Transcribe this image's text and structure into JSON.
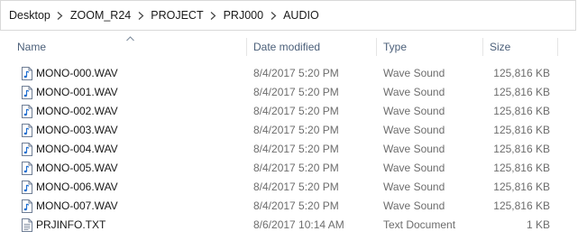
{
  "breadcrumb": [
    "Desktop",
    "ZOOM_R24",
    "PROJECT",
    "PRJ000",
    "AUDIO"
  ],
  "columns": {
    "name": "Name",
    "date": "Date modified",
    "type": "Type",
    "size": "Size"
  },
  "sort": {
    "column": "name",
    "direction": "ascending"
  },
  "files": [
    {
      "name": "MONO-000.WAV",
      "date": "8/4/2017 5:20 PM",
      "type": "Wave Sound",
      "size": "125,816 KB",
      "icon": "audio-file-icon"
    },
    {
      "name": "MONO-001.WAV",
      "date": "8/4/2017 5:20 PM",
      "type": "Wave Sound",
      "size": "125,816 KB",
      "icon": "audio-file-icon"
    },
    {
      "name": "MONO-002.WAV",
      "date": "8/4/2017 5:20 PM",
      "type": "Wave Sound",
      "size": "125,816 KB",
      "icon": "audio-file-icon"
    },
    {
      "name": "MONO-003.WAV",
      "date": "8/4/2017 5:20 PM",
      "type": "Wave Sound",
      "size": "125,816 KB",
      "icon": "audio-file-icon"
    },
    {
      "name": "MONO-004.WAV",
      "date": "8/4/2017 5:20 PM",
      "type": "Wave Sound",
      "size": "125,816 KB",
      "icon": "audio-file-icon"
    },
    {
      "name": "MONO-005.WAV",
      "date": "8/4/2017 5:20 PM",
      "type": "Wave Sound",
      "size": "125,816 KB",
      "icon": "audio-file-icon"
    },
    {
      "name": "MONO-006.WAV",
      "date": "8/4/2017 5:20 PM",
      "type": "Wave Sound",
      "size": "125,816 KB",
      "icon": "audio-file-icon"
    },
    {
      "name": "MONO-007.WAV",
      "date": "8/4/2017 5:20 PM",
      "type": "Wave Sound",
      "size": "125,816 KB",
      "icon": "audio-file-icon"
    },
    {
      "name": "PRJINFO.TXT",
      "date": "8/6/2017 10:14 AM",
      "type": "Text Document",
      "size": "1 KB",
      "icon": "text-file-icon"
    }
  ]
}
